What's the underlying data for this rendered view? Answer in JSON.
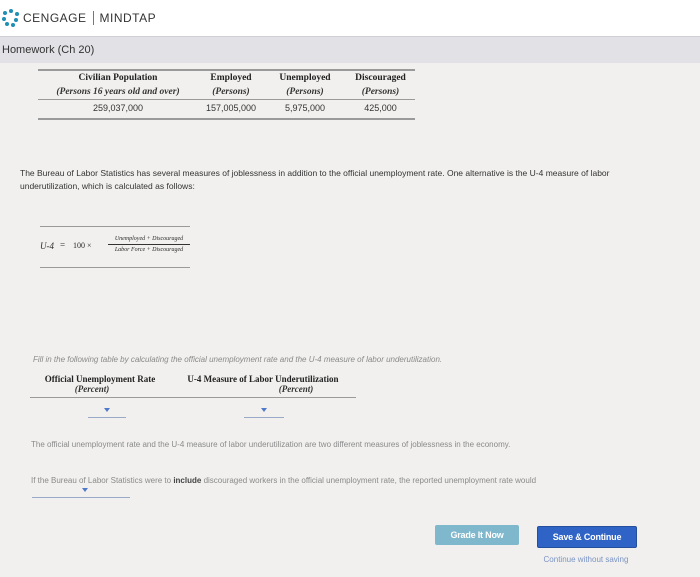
{
  "header": {
    "brand": "CENGAGE",
    "product": "MINDTAP",
    "page_title": "Homework (Ch 20)"
  },
  "data_table": {
    "headers": [
      "Civilian Population",
      "Employed",
      "Unemployed",
      "Discouraged"
    ],
    "subheaders": [
      "(Persons 16 years old and over)",
      "(Persons)",
      "(Persons)",
      "(Persons)"
    ],
    "values": [
      "259,037,000",
      "157,005,000",
      "5,975,000",
      "425,000"
    ]
  },
  "intro": {
    "text": "The Bureau of Labor Statistics has several measures of joblessness in addition to the official unemployment rate. One alternative is the U-4 measure of labor underutilization, which is calculated as follows:"
  },
  "formula": {
    "lhs": "U-4",
    "equals": "=",
    "coefficient": "100 ×",
    "numerator": "Unemployed + Discouraged",
    "denominator": "Labor Force + Discouraged"
  },
  "instruction": {
    "text": "Fill in the following table by calculating the official unemployment rate and the U-4 measure of labor underutilization."
  },
  "answer_table": {
    "col1_header": "Official Unemployment Rate",
    "col1_sub": "(Percent)",
    "col2_header": "U-4 Measure of Labor Underutilization",
    "col2_sub": "(Percent)"
  },
  "statement": {
    "text": "The official unemployment rate and the U-4 measure of labor underutilization are two different measures of joblessness in the economy."
  },
  "question": {
    "part1": "If the Bureau of Labor Statistics were to",
    "bold": "include",
    "part2": "discouraged workers in the official unemployment rate, the reported unemployment rate would"
  },
  "buttons": {
    "grade": "Grade It Now",
    "save": "Save & Continue",
    "continue_link": "Continue without saving"
  }
}
